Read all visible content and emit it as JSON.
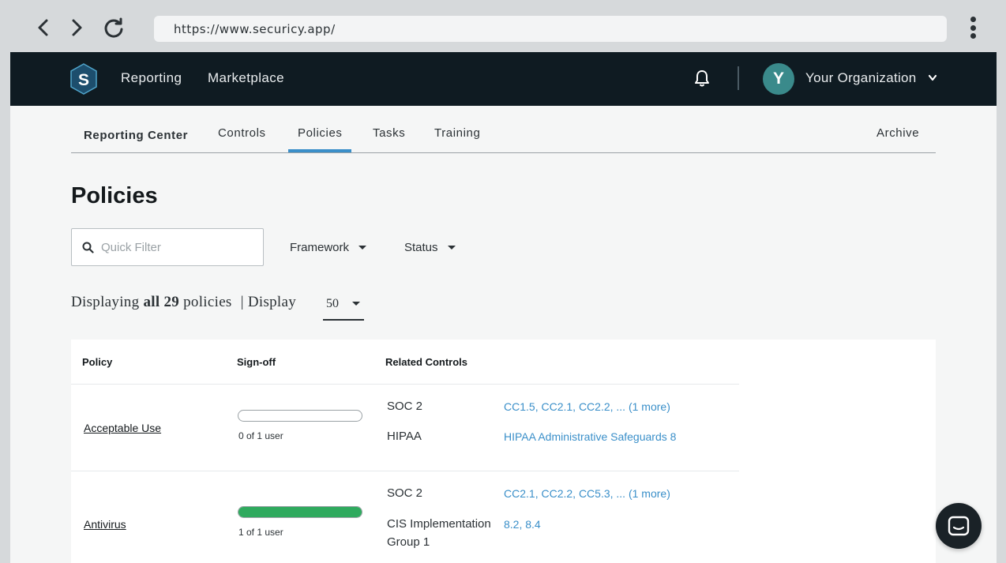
{
  "browser": {
    "url": "https://www.securicy.app/"
  },
  "topnav": {
    "logo_letter": "S",
    "links": [
      "Reporting",
      "Marketplace"
    ],
    "avatar_letter": "Y",
    "org_name": "Your Organization"
  },
  "subnav": {
    "title": "Reporting Center",
    "tabs": [
      "Controls",
      "Policies",
      "Tasks",
      "Training"
    ],
    "active_tab": "Policies",
    "archive": "Archive"
  },
  "page": {
    "title": "Policies",
    "filter_placeholder": "Quick Filter",
    "framework_label": "Framework",
    "status_label": "Status",
    "display_prefix": "Displaying",
    "display_count": "all 29",
    "display_suffix": "policies",
    "display_sep": "| Display",
    "display_value": "50"
  },
  "table": {
    "headers": [
      "Policy",
      "Sign-off",
      "Related Controls"
    ],
    "rows": [
      {
        "policy": "Acceptable Use",
        "signoff_text": "0 of 1 user",
        "signoff_progress": 0,
        "frameworks": [
          {
            "name": "SOC 2",
            "controls": [
              "CC1.5",
              "CC2.1",
              "CC2.2",
              "... (1 more)"
            ]
          },
          {
            "name": "HIPAA",
            "controls": [
              "HIPAA Administrative Safeguards 8"
            ]
          }
        ]
      },
      {
        "policy": "Antivirus",
        "signoff_text": "1 of 1 user",
        "signoff_progress": 1,
        "frameworks": [
          {
            "name": "SOC 2",
            "controls": [
              "CC2.1",
              "CC2.2",
              "CC5.3",
              "... (1 more)"
            ]
          },
          {
            "name": "CIS Implementation Group 1",
            "controls": [
              "8.2",
              "8.4"
            ]
          }
        ]
      }
    ]
  },
  "colors": {
    "nav_bg": "#0f1b22",
    "accent": "#3a8fc9",
    "progress_green": "#2faa5e",
    "avatar": "#3a8a8b"
  }
}
